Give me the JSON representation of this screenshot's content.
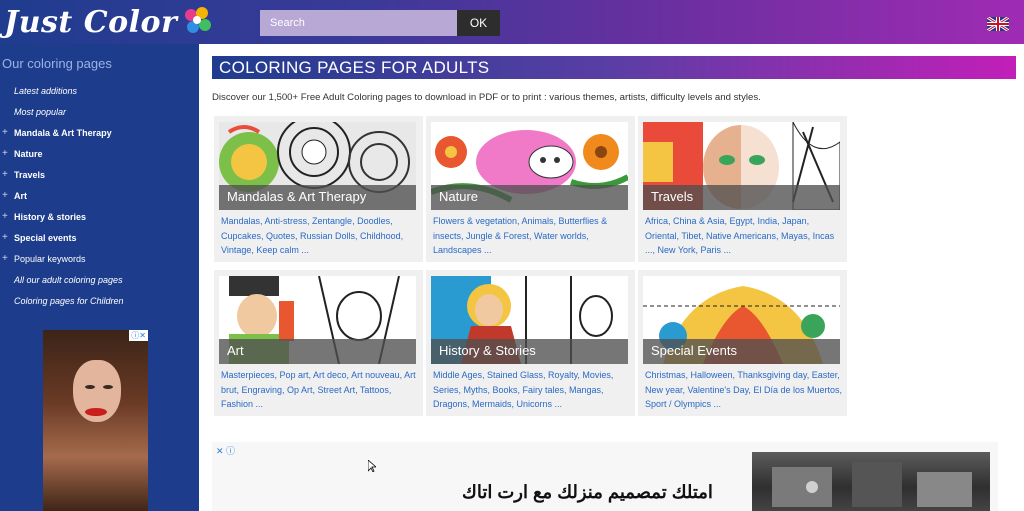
{
  "header": {
    "logo_text": "Just Color",
    "search_placeholder": "Search",
    "search_button": "OK",
    "flag_icon": "uk-flag-icon"
  },
  "sidebar": {
    "title": "Our coloring pages",
    "items": [
      {
        "label": "Latest additions",
        "style": "italic",
        "expandable": false
      },
      {
        "label": "Most popular",
        "style": "italic",
        "expandable": false
      },
      {
        "label": "Mandala & Art Therapy",
        "style": "bold",
        "expandable": true
      },
      {
        "label": "Nature",
        "style": "bold",
        "expandable": true
      },
      {
        "label": "Travels",
        "style": "bold",
        "expandable": true
      },
      {
        "label": "Art",
        "style": "bold",
        "expandable": true
      },
      {
        "label": "History & stories",
        "style": "bold",
        "expandable": true
      },
      {
        "label": "Special events",
        "style": "bold",
        "expandable": true
      },
      {
        "label": "Popular keywords",
        "style": "normal",
        "expandable": true
      },
      {
        "label": "All our adult coloring pages",
        "style": "italic",
        "expandable": false
      },
      {
        "label": "Coloring pages for Children",
        "style": "italic",
        "expandable": false
      }
    ]
  },
  "main": {
    "banner_title": "COLORING PAGES FOR ADULTS",
    "intro": "Discover our 1,500+ Free Adult Coloring pages to download in PDF or to print : various themes, artists, difficulty levels and styles.",
    "cards": [
      {
        "title": "Mandalas & Art Therapy",
        "links": "Mandalas, Anti-stress, Zentangle, Doodles, Cupcakes, Quotes, Russian Dolls, Childhood, Vintage, Keep calm ..."
      },
      {
        "title": "Nature",
        "links": "Flowers & vegetation, Animals, Butterflies & insects, Jungle & Forest, Water worlds, Landscapes ..."
      },
      {
        "title": "Travels",
        "links": "Africa, China & Asia, Egypt, India, Japan, Oriental, Tibet, Native Americans, Mayas, Incas ..., New York, Paris ..."
      },
      {
        "title": "Art",
        "links": "Masterpieces, Pop art, Art deco, Art nouveau, Art brut, Engraving, Op Art, Street Art, Tattoos, Fashion ..."
      },
      {
        "title": "History & Stories",
        "links": "Middle Ages, Stained Glass, Royalty, Movies, Series, Myths, Books, Fairy tales, Mangas, Dragons, Mermaids, Unicorns ..."
      },
      {
        "title": "Special Events",
        "links": "Christmas, Halloween, Thanksgiving day, Easter, New year, Valentine's Day, El Día de los Muertos, Sport / Olympics ..."
      }
    ]
  },
  "ads": {
    "side_ad_badge": "ⓘ✕",
    "bottom_ad_icons": "✕ ⓘ",
    "bottom_ad_text": "امتلك تمصميم منزلك مع ارت اتاك"
  },
  "colors": {
    "header_gradient_start": "#1f3c8e",
    "header_gradient_end": "#a02bb4",
    "sidebar_bg": "#1d3c8c",
    "link_blue": "#2a69c6"
  }
}
